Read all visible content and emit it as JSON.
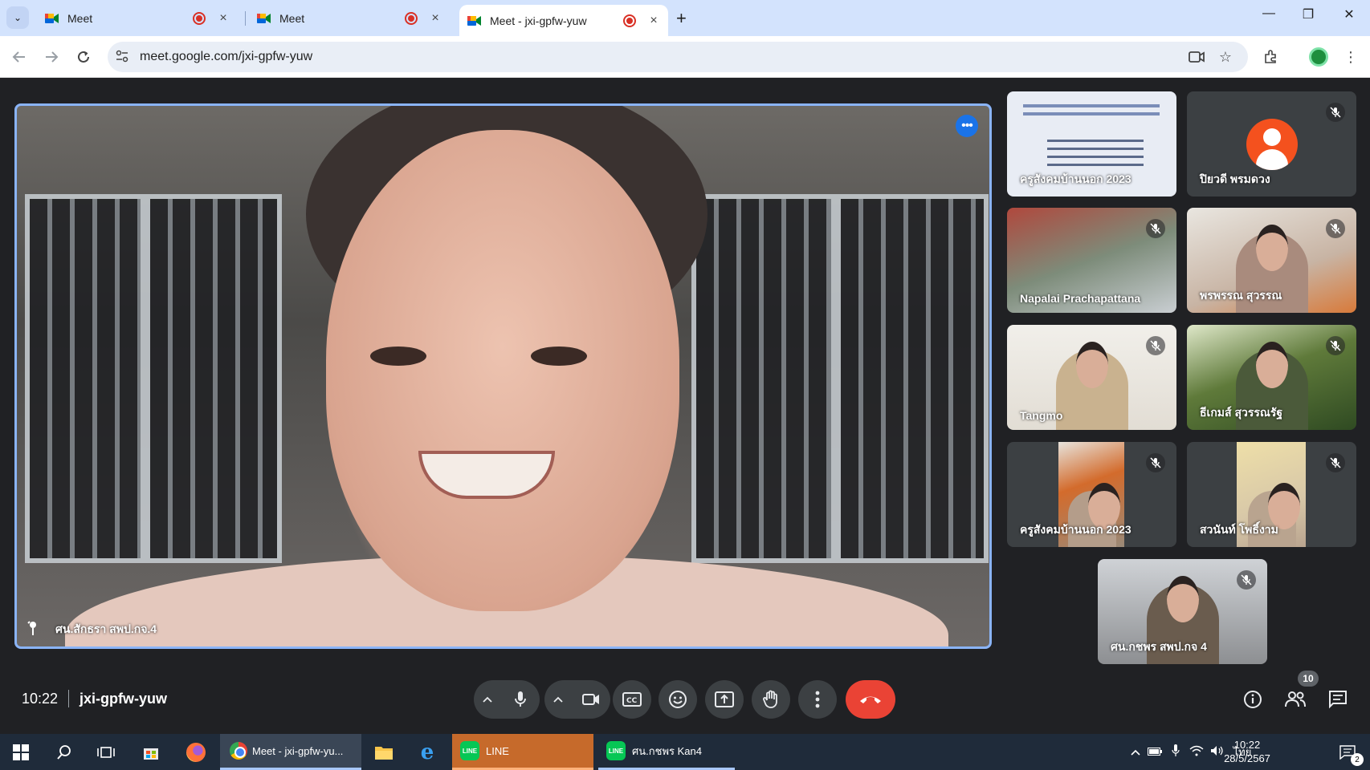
{
  "browser": {
    "tabs": [
      {
        "title": "Meet",
        "active": false
      },
      {
        "title": "Meet",
        "active": false
      },
      {
        "title": "Meet - jxi-gpfw-yuw",
        "active": true
      }
    ],
    "new_tab_symbol": "+",
    "close_symbol": "×",
    "url": "meet.google.com/jxi-gpfw-yuw",
    "window_controls": {
      "minimize": "—",
      "restore": "❐",
      "close": "✕"
    }
  },
  "meet": {
    "main_speaker": {
      "name": "ศน.สักธรา สพป.กจ.4"
    },
    "participants": [
      {
        "name": "ครูสังคมบ้านนอก 2023",
        "kind": "presentation",
        "muted": false
      },
      {
        "name": "ปิยวดี พรมดวง",
        "kind": "avatar",
        "muted": true
      },
      {
        "name": "Napalai Prachapattana",
        "kind": "video",
        "muted": true
      },
      {
        "name": "พรพรรณ สุวรรณ",
        "kind": "video",
        "muted": true
      },
      {
        "name": "Tangmo",
        "kind": "video",
        "muted": true
      },
      {
        "name": "ธีเกมส์ สุวรรณรัฐ",
        "kind": "video",
        "muted": true
      },
      {
        "name": "ครูสังคมบ้านนอก 2023",
        "kind": "video",
        "muted": true
      },
      {
        "name": "สวนันท์ โพธิ์งาม",
        "kind": "video",
        "muted": true
      },
      {
        "name": "ศน.กชพร สพป.กจ 4",
        "kind": "video",
        "muted": true
      }
    ],
    "meeting_time": "10:22",
    "meeting_code": "jxi-gpfw-yuw",
    "participant_count": "10"
  },
  "taskbar": {
    "chrome_label": "Meet - jxi-gpfw-yu...",
    "line_label": "LINE",
    "line_chat_label": "ศน.กชพร Kan4",
    "line_icon_text": "LINE",
    "language": "ไทย",
    "time": "10:22",
    "date": "28/5/2567",
    "notification_count": "2"
  },
  "colors": {
    "meet_bg": "#202124",
    "control_bg": "#3c4043",
    "end_call": "#ea4335",
    "active_speaker_border": "#8ab4f8",
    "tabstrip": "#d3e3fd"
  }
}
